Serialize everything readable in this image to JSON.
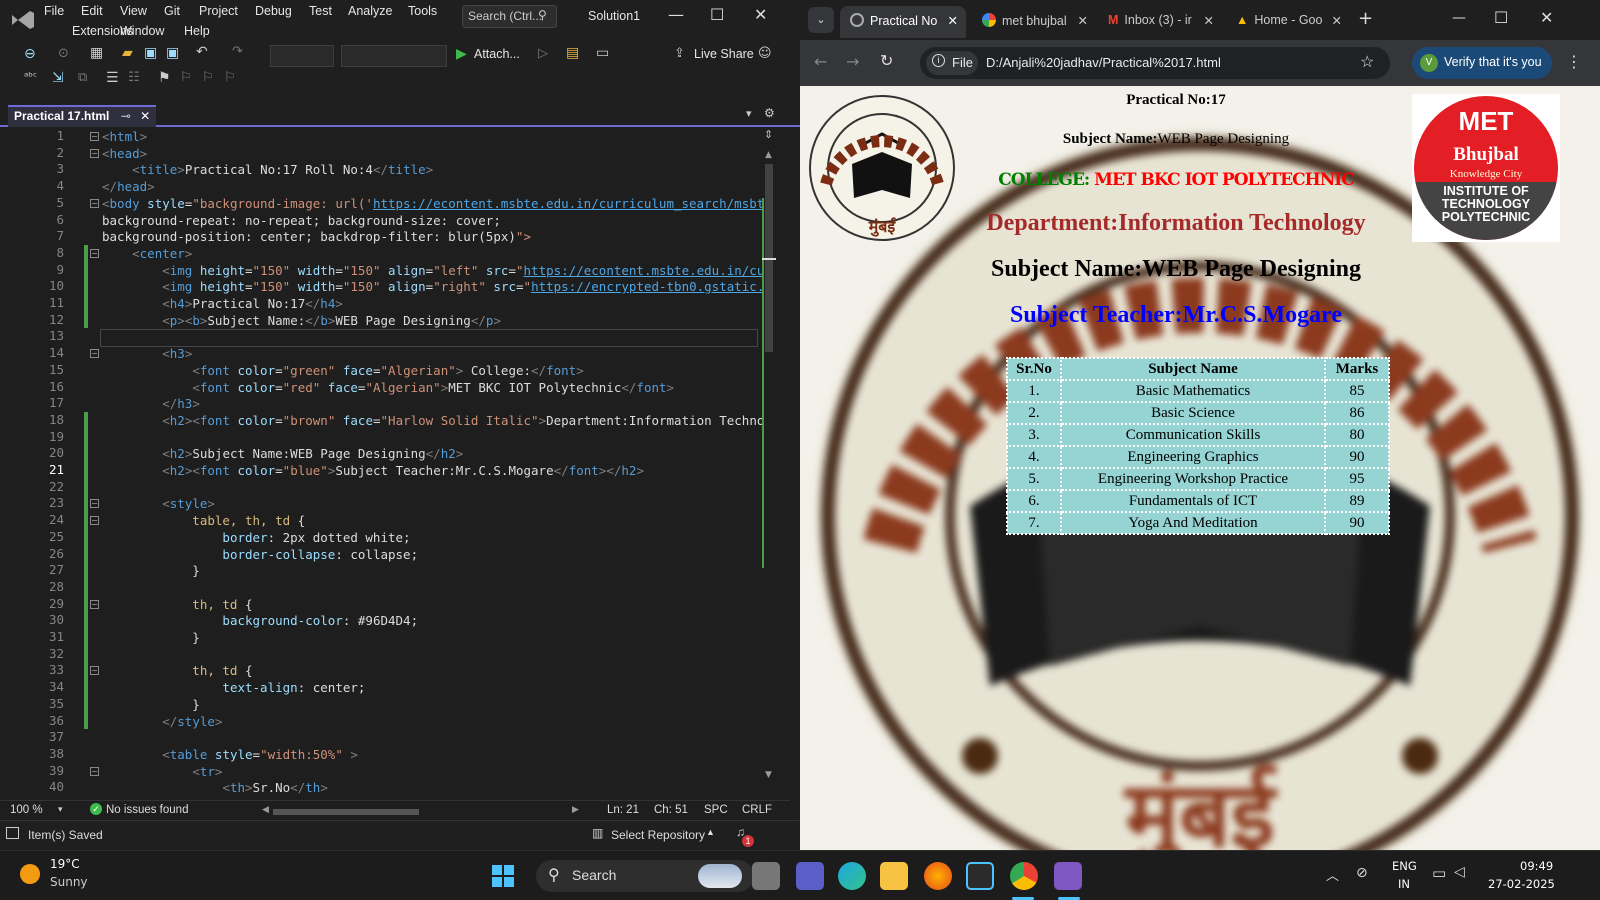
{
  "vs": {
    "menu": [
      "File",
      "Edit",
      "View",
      "Git",
      "Project",
      "Debug",
      "Test",
      "Analyze",
      "Tools",
      "Extensions",
      "Window",
      "Help"
    ],
    "search_placeholder": "Search (Ctrl...",
    "solution_name": "Solution1",
    "toolbar": {
      "attach_label": "Attach...",
      "live_share_label": "Live Share"
    },
    "doc_tab": "Practical 17.html",
    "code_lines": [
      "<html>",
      "<head>",
      "    <title>Practical No:17 Roll No:4</title>",
      "</head>",
      "<body style=\"background-image: url('https://econtent.msbte.edu.in/curriculum_search/msbt",
      "background-repeat: no-repeat; background-size: cover;",
      "background-position: center; backdrop-filter: blur(5px)\">",
      "    <center>",
      "        <img height=\"150\" width=\"150\" align=\"left\" src=\"https://econtent.msbte.edu.in/cu",
      "        <img height=\"150\" width=\"150\" align=\"right\" src=\"https://encrypted-tbn0.gstatic.",
      "        <h4>Practical No:17</h4>",
      "        <p><b>Subject Name:</b>WEB Page Designing</p>",
      "",
      "        <h3>",
      "            <font color=\"green\" face=\"Algerian\"> College:</font>",
      "            <font color=\"red\" face=\"Algerian\">MET BKC IOT Polytechnic</font>",
      "        </h3>",
      "        <h2><font color=\"brown\" face=\"Harlow Solid Italic\">Department:Information Techno",
      "",
      "        <h2>Subject Name:WEB Page Designing</h2>",
      "        <h2><font color=\"blue\">Subject Teacher:Mr.C.S.Mogare</font></h2>",
      "",
      "        <style>",
      "            table, th, td {",
      "                border: 2px dotted white;",
      "                border-collapse: collapse;",
      "            }",
      "",
      "            th, td {",
      "                background-color: #96D4D4;",
      "            }",
      "",
      "            th, td {",
      "                text-align: center;",
      "            }",
      "        </style>",
      "",
      "        <table style=\"width:50%\" >",
      "            <tr>",
      "                <th>Sr.No</th>"
    ],
    "status": {
      "zoom": "100 %",
      "issues": "No issues found",
      "ln": "Ln: 21",
      "ch": "Ch: 51",
      "spc": "SPC",
      "crlf": "CRLF"
    },
    "bottom": {
      "saved": "Item(s) Saved",
      "repo": "Select Repository",
      "notif_count": "1"
    }
  },
  "chrome": {
    "tabs": [
      {
        "label": "Practical No"
      },
      {
        "label": "met bhujbal"
      },
      {
        "label": "Inbox (3) - ir"
      },
      {
        "label": "Home - Goo"
      }
    ],
    "file_label": "File",
    "url": "D:/Anjali%20jadhav/Practical%2017.html",
    "verify_label": "Verify that it's you"
  },
  "page": {
    "practical": "Practical No:17",
    "subject_label": "Subject Name:",
    "subject_value": "WEB Page Designing",
    "college_label": "COLLEGE:",
    "college_value": "MET BKC IOT POLYTECHNIC",
    "department": "Department:Information Technology",
    "subject_h2": "Subject Name:WEB Page Designing",
    "teacher": "Subject Teacher:Mr.C.S.Mogare",
    "logo_right": {
      "top": "MET",
      "name": "Bhujbal",
      "sub": "Knowledge City",
      "inst1": "INSTITUTE OF",
      "inst2": "TECHNOLOGY",
      "inst3": "POLYTECHNIC"
    },
    "logo_left_text": "मुंबई",
    "table": {
      "headers": [
        "Sr.No",
        "Subject Name",
        "Marks"
      ],
      "rows": [
        [
          "1.",
          "Basic Mathematics",
          "85"
        ],
        [
          "2.",
          "Basic Science",
          "86"
        ],
        [
          "3.",
          "Communication Skills",
          "80"
        ],
        [
          "4.",
          "Engineering Graphics",
          "90"
        ],
        [
          "5.",
          "Engineering Workshop Practice",
          "95"
        ],
        [
          "6.",
          "Fundamentals of ICT",
          "89"
        ],
        [
          "7.",
          "Yoga And Meditation",
          "90"
        ]
      ]
    }
  },
  "taskbar": {
    "weather_temp": "19°C",
    "weather_desc": "Sunny",
    "search_label": "Search",
    "lang1": "ENG",
    "lang2": "IN",
    "time": "09:49",
    "date": "27-02-2025"
  },
  "colors": {
    "table_bg": "#96D4D4",
    "accent": "#6e6ad6",
    "college_green": "#008000",
    "college_red": "#ff0000",
    "dept_brown": "#a52a2a",
    "teacher_blue": "#0000ff"
  }
}
